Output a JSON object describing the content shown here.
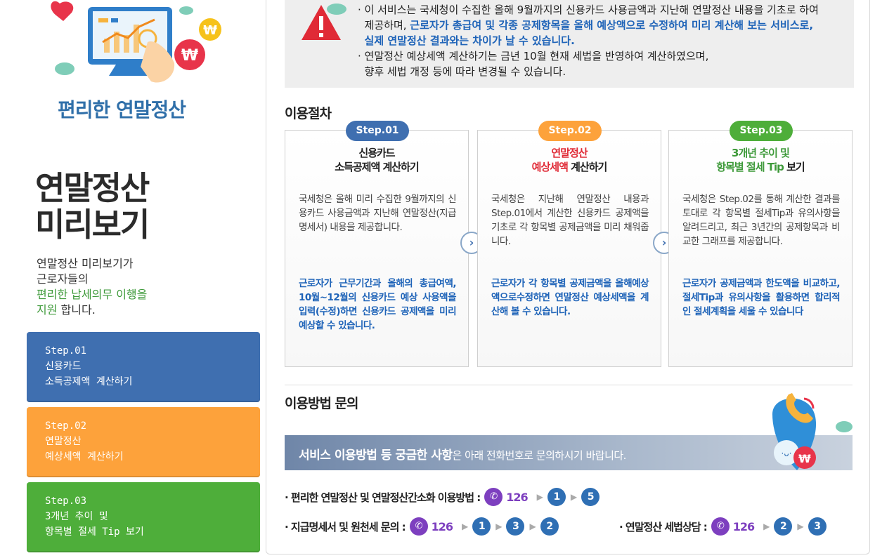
{
  "left": {
    "brand_title": "편리한 연말정산",
    "main_title_1": "연말정산",
    "main_title_2": "미리보기",
    "desc_1": "연말정산 미리보기가",
    "desc_2": "근로자들의",
    "desc_3": "편리한 납세의무 이행을",
    "desc_4a": "지원",
    "desc_4b": " 합니다.",
    "steps": [
      {
        "label": "Step.01",
        "line1": "신용카드",
        "line2": "소득공제액 계산하기"
      },
      {
        "label": "Step.02",
        "line1": "연말정산",
        "line2": "예상세액 계산하기"
      },
      {
        "label": "Step.03",
        "line1": "3개년 추이 및",
        "line2": "항목별 절세 Tip 보기"
      }
    ]
  },
  "notice": {
    "l1": "· 이 서비스는 국세청이 수집한 올해 9월까지의 신용카드 사용금액과 지난해 연말정산 내용을 기초로 하여",
    "l2a": "제공하며, ",
    "l2b": "근로자가 총급여 및 각종 공제항목을 올해 예상액으로 수정하여 미리 계산해 보는 서비스로,",
    "l3": "실제 연말정산 결과와는 차이가 날 수 있습니다.",
    "l4": "· 연말정산 예상세액 계산하기는 금년 10월 현재 세법을 반영하여 계산하였으며,",
    "l5": "향후 세법 개정 등에 따라 변경될 수 있습니다."
  },
  "procedure": {
    "title": "이용절차",
    "cards": [
      {
        "badge": "Step.01",
        "title1": "신용카드",
        "title2": "소득공제액 계산하기",
        "body": "국세청은 올해 미리 수집한 9월까지의 신용카드 사용금액과 지난해 연말정산(지급명세서) 내용을 제공합니다.",
        "note": "근로자가 근무기간과 올해의 총급여액, 10월~12월의 신용카드 예상 사용액을 입력(수정)하면 신용카드 공제액을 미리 예상할 수 있습니다."
      },
      {
        "badge": "Step.02",
        "title1": "연말정산",
        "title2a": "예상세액",
        "title2b": " 계산하기",
        "body": "국세청은 지난해 연말정산 내용과 Step.01에서 계산한 신용카드 공제액을 기초로 각 항목별 공제금액을 미리 채워줍니다.",
        "note": "근로자가 각 항목별 공제금액을 올해예상액으로수정하면 연말정산 예상세액을 계산해 볼 수 있습니다."
      },
      {
        "badge": "Step.03",
        "title1": "3개년 추이 및",
        "title2a": "항목별 절세 Tip",
        "title2b": " 보기",
        "body": "국세청은 Step.02를 통해 계산한 결과를 토대로 각 항목별 절세Tip과 유의사항을 알려드리고, 최근 3년간의 공제항목과 비교한 그래프를 제공합니다.",
        "note": "근로자가 공제금액과 한도액을 비교하고, 절세Tip과 유의사항을 활용하면 합리적인 절세계획을 세울 수 있습니다"
      }
    ],
    "arrow": "›"
  },
  "inquiry": {
    "title": "이용방법 문의",
    "banner_bold": "서비스 이용방법 등 궁금한 사항",
    "banner_rest": "은 아래 전화번호로 문의하시기 바랍니다.",
    "rows": [
      {
        "label": "· 편리한 연말정산 및 연말정산간소화 이용방법 :",
        "code": "126",
        "nums": [
          "1",
          "5"
        ]
      },
      {
        "label": "· 지급명세서  및 원천세 문의 :",
        "code": "126",
        "nums": [
          "1",
          "3",
          "2"
        ]
      },
      {
        "label": "· 연말정산 세법상담  :",
        "code": "126",
        "nums": [
          "2",
          "3"
        ]
      }
    ]
  },
  "colors": {
    "step1": "#3f6fb0",
    "step2": "#fda23b",
    "step3": "#4eae3a",
    "accent_blue": "#1e63b8",
    "phone": "#7d3fbf"
  },
  "icons": [
    "monitor-chart-illustration",
    "warning-icon",
    "phone-icon",
    "won-coin-icon"
  ]
}
